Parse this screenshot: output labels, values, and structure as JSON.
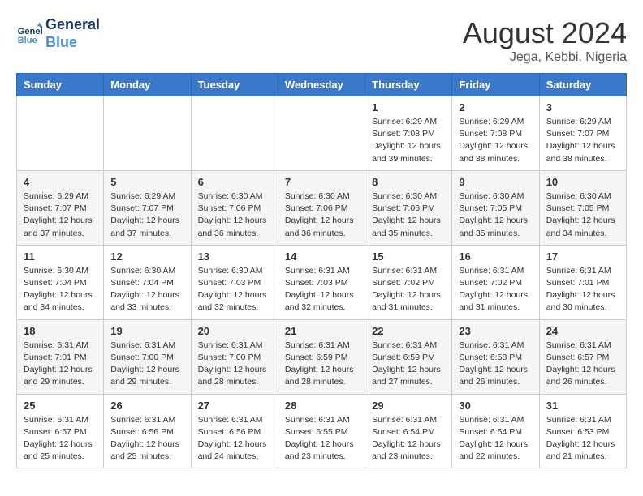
{
  "header": {
    "logo_line1": "General",
    "logo_line2": "Blue",
    "month_year": "August 2024",
    "location": "Jega, Kebbi, Nigeria"
  },
  "days_of_week": [
    "Sunday",
    "Monday",
    "Tuesday",
    "Wednesday",
    "Thursday",
    "Friday",
    "Saturday"
  ],
  "weeks": [
    [
      {
        "day": "",
        "info": ""
      },
      {
        "day": "",
        "info": ""
      },
      {
        "day": "",
        "info": ""
      },
      {
        "day": "",
        "info": ""
      },
      {
        "day": "1",
        "info": "Sunrise: 6:29 AM\nSunset: 7:08 PM\nDaylight: 12 hours\nand 39 minutes."
      },
      {
        "day": "2",
        "info": "Sunrise: 6:29 AM\nSunset: 7:08 PM\nDaylight: 12 hours\nand 38 minutes."
      },
      {
        "day": "3",
        "info": "Sunrise: 6:29 AM\nSunset: 7:07 PM\nDaylight: 12 hours\nand 38 minutes."
      }
    ],
    [
      {
        "day": "4",
        "info": "Sunrise: 6:29 AM\nSunset: 7:07 PM\nDaylight: 12 hours\nand 37 minutes."
      },
      {
        "day": "5",
        "info": "Sunrise: 6:29 AM\nSunset: 7:07 PM\nDaylight: 12 hours\nand 37 minutes."
      },
      {
        "day": "6",
        "info": "Sunrise: 6:30 AM\nSunset: 7:06 PM\nDaylight: 12 hours\nand 36 minutes."
      },
      {
        "day": "7",
        "info": "Sunrise: 6:30 AM\nSunset: 7:06 PM\nDaylight: 12 hours\nand 36 minutes."
      },
      {
        "day": "8",
        "info": "Sunrise: 6:30 AM\nSunset: 7:06 PM\nDaylight: 12 hours\nand 35 minutes."
      },
      {
        "day": "9",
        "info": "Sunrise: 6:30 AM\nSunset: 7:05 PM\nDaylight: 12 hours\nand 35 minutes."
      },
      {
        "day": "10",
        "info": "Sunrise: 6:30 AM\nSunset: 7:05 PM\nDaylight: 12 hours\nand 34 minutes."
      }
    ],
    [
      {
        "day": "11",
        "info": "Sunrise: 6:30 AM\nSunset: 7:04 PM\nDaylight: 12 hours\nand 34 minutes."
      },
      {
        "day": "12",
        "info": "Sunrise: 6:30 AM\nSunset: 7:04 PM\nDaylight: 12 hours\nand 33 minutes."
      },
      {
        "day": "13",
        "info": "Sunrise: 6:30 AM\nSunset: 7:03 PM\nDaylight: 12 hours\nand 32 minutes."
      },
      {
        "day": "14",
        "info": "Sunrise: 6:31 AM\nSunset: 7:03 PM\nDaylight: 12 hours\nand 32 minutes."
      },
      {
        "day": "15",
        "info": "Sunrise: 6:31 AM\nSunset: 7:02 PM\nDaylight: 12 hours\nand 31 minutes."
      },
      {
        "day": "16",
        "info": "Sunrise: 6:31 AM\nSunset: 7:02 PM\nDaylight: 12 hours\nand 31 minutes."
      },
      {
        "day": "17",
        "info": "Sunrise: 6:31 AM\nSunset: 7:01 PM\nDaylight: 12 hours\nand 30 minutes."
      }
    ],
    [
      {
        "day": "18",
        "info": "Sunrise: 6:31 AM\nSunset: 7:01 PM\nDaylight: 12 hours\nand 29 minutes."
      },
      {
        "day": "19",
        "info": "Sunrise: 6:31 AM\nSunset: 7:00 PM\nDaylight: 12 hours\nand 29 minutes."
      },
      {
        "day": "20",
        "info": "Sunrise: 6:31 AM\nSunset: 7:00 PM\nDaylight: 12 hours\nand 28 minutes."
      },
      {
        "day": "21",
        "info": "Sunrise: 6:31 AM\nSunset: 6:59 PM\nDaylight: 12 hours\nand 28 minutes."
      },
      {
        "day": "22",
        "info": "Sunrise: 6:31 AM\nSunset: 6:59 PM\nDaylight: 12 hours\nand 27 minutes."
      },
      {
        "day": "23",
        "info": "Sunrise: 6:31 AM\nSunset: 6:58 PM\nDaylight: 12 hours\nand 26 minutes."
      },
      {
        "day": "24",
        "info": "Sunrise: 6:31 AM\nSunset: 6:57 PM\nDaylight: 12 hours\nand 26 minutes."
      }
    ],
    [
      {
        "day": "25",
        "info": "Sunrise: 6:31 AM\nSunset: 6:57 PM\nDaylight: 12 hours\nand 25 minutes."
      },
      {
        "day": "26",
        "info": "Sunrise: 6:31 AM\nSunset: 6:56 PM\nDaylight: 12 hours\nand 25 minutes."
      },
      {
        "day": "27",
        "info": "Sunrise: 6:31 AM\nSunset: 6:56 PM\nDaylight: 12 hours\nand 24 minutes."
      },
      {
        "day": "28",
        "info": "Sunrise: 6:31 AM\nSunset: 6:55 PM\nDaylight: 12 hours\nand 23 minutes."
      },
      {
        "day": "29",
        "info": "Sunrise: 6:31 AM\nSunset: 6:54 PM\nDaylight: 12 hours\nand 23 minutes."
      },
      {
        "day": "30",
        "info": "Sunrise: 6:31 AM\nSunset: 6:54 PM\nDaylight: 12 hours\nand 22 minutes."
      },
      {
        "day": "31",
        "info": "Sunrise: 6:31 AM\nSunset: 6:53 PM\nDaylight: 12 hours\nand 21 minutes."
      }
    ]
  ]
}
